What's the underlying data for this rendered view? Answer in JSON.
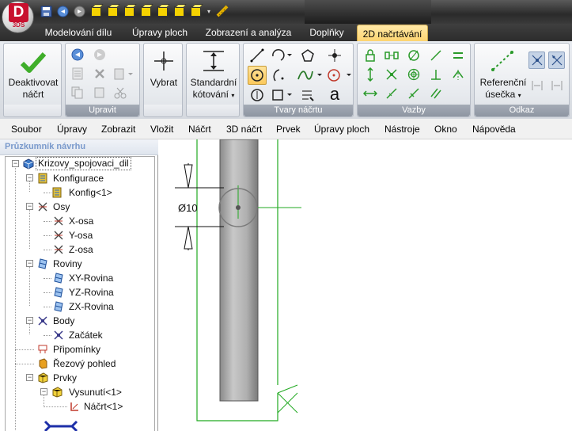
{
  "app": {
    "logo_letter": "D",
    "logo_sub": "3DS"
  },
  "tabs": [
    "Modelování dílu",
    "Úpravy ploch",
    "Zobrazení a analýza",
    "Doplňky",
    "2D načrtávání"
  ],
  "ribbon": {
    "deactivate": {
      "line1": "Deaktivovat",
      "line2": "náčrt"
    },
    "edit_group": "Upravit",
    "select": "Vybrat",
    "dimension": {
      "line1": "Standardní",
      "line2": "kótování"
    },
    "shapes_group": "Tvary náčrtu",
    "shape_text_glyph": "a",
    "constraints_group": "Vazby",
    "reference": {
      "line1": "Referenční",
      "line2": "úsečka"
    },
    "reference_group": "Odkaz"
  },
  "menu": [
    "Soubor",
    "Úpravy",
    "Zobrazit",
    "Vložit",
    "Náčrt",
    "3D náčrt",
    "Prvek",
    "Úpravy ploch",
    "Nástroje",
    "Okno",
    "Nápověda"
  ],
  "panel": {
    "title": "Průzkumník návrhu"
  },
  "tree": {
    "root": "Krizovy_spojovaci_dil",
    "configurations": "Konfigurace",
    "config1": "Konfig<1>",
    "axes": "Osy",
    "axis_x": "X-osa",
    "axis_y": "Y-osa",
    "axis_z": "Z-osa",
    "planes": "Roviny",
    "plane_xy": "XY-Rovina",
    "plane_yz": "YZ-Rovina",
    "plane_zx": "ZX-Rovina",
    "points": "Body",
    "origin": "Začátek",
    "notes": "Připomínky",
    "section_view": "Řezový pohled",
    "features": "Prvky",
    "extrude": "Vysunutí<1>",
    "sketch": "Náčrt<1>"
  },
  "drawing": {
    "dimension_text": "Ø10"
  },
  "colors": {
    "ribbon_label": "#8e96a2",
    "active_tab": "#fdd36d",
    "sketch_green": "#22aa22",
    "canvas_bg": "#eaf3ea"
  }
}
